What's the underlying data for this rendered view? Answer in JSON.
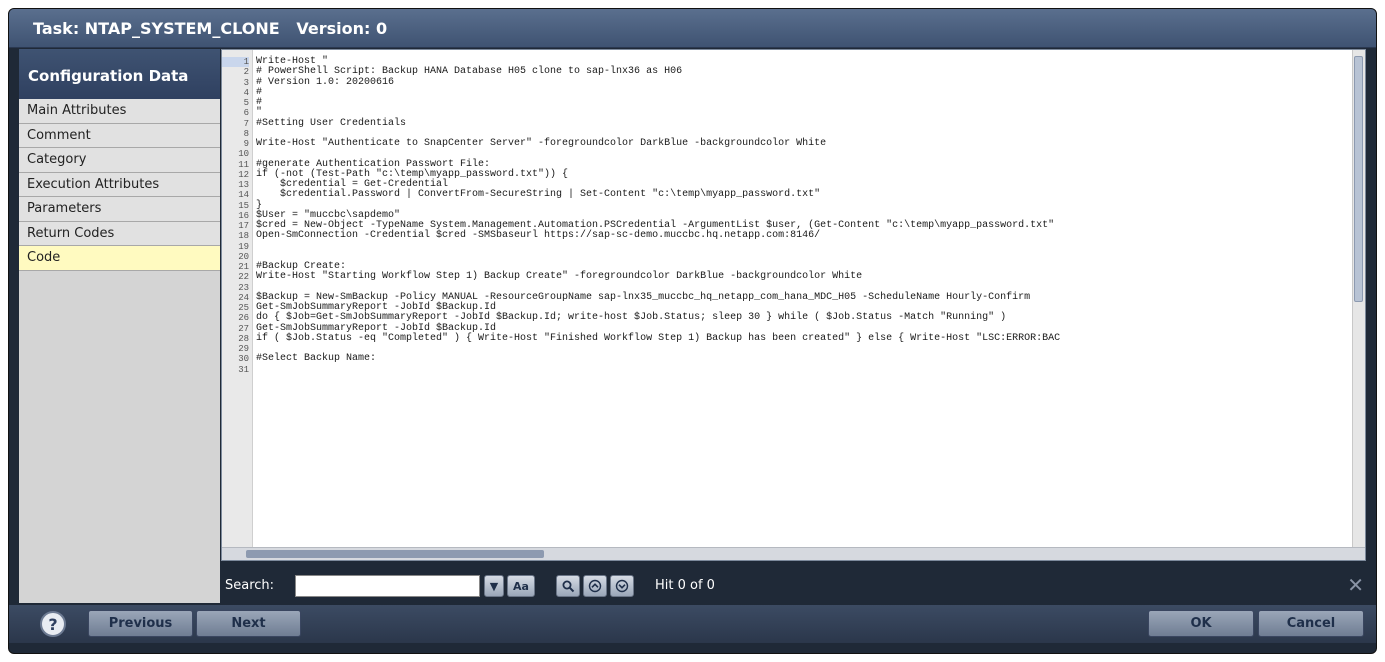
{
  "window": {
    "title": "Task: NTAP_SYSTEM_CLONE",
    "version_label": "Version: 0"
  },
  "sidebar": {
    "header": "Configuration Data",
    "items": [
      {
        "label": "Main Attributes"
      },
      {
        "label": "Comment"
      },
      {
        "label": "Category"
      },
      {
        "label": "Execution Attributes"
      },
      {
        "label": "Parameters"
      },
      {
        "label": "Return Codes"
      },
      {
        "label": "Code"
      }
    ],
    "active_item": "Code"
  },
  "editor": {
    "lines": [
      {
        "n": "1",
        "text": "Write-Host \""
      },
      {
        "n": "2",
        "text": "# PowerShell Script: Backup HANA Database H05 clone to sap-lnx36 as H06"
      },
      {
        "n": "3",
        "text": "# Version 1.0: 20200616"
      },
      {
        "n": "4",
        "text": "#"
      },
      {
        "n": "5",
        "text": "#"
      },
      {
        "n": "6",
        "text": "\""
      },
      {
        "n": "7",
        "text": "#Setting User Credentials"
      },
      {
        "n": "8",
        "text": ""
      },
      {
        "n": "9",
        "text": "Write-Host \"Authenticate to SnapCenter Server\" -foregroundcolor DarkBlue -backgroundcolor White"
      },
      {
        "n": "10",
        "text": ""
      },
      {
        "n": "11",
        "text": "#generate Authentication Passwort File:"
      },
      {
        "n": "12",
        "text": "if (-not (Test-Path \"c:\\temp\\myapp_password.txt\")) {"
      },
      {
        "n": "13",
        "text": "    $credential = Get-Credential"
      },
      {
        "n": "14",
        "text": "    $credential.Password | ConvertFrom-SecureString | Set-Content \"c:\\temp\\myapp_password.txt\""
      },
      {
        "n": "15",
        "text": "}"
      },
      {
        "n": "16",
        "text": "$User = \"muccbc\\sapdemo\""
      },
      {
        "n": "17",
        "text": "$cred = New-Object -TypeName System.Management.Automation.PSCredential -ArgumentList $user, (Get-Content \"c:\\temp\\myapp_password.txt\""
      },
      {
        "n": "18",
        "text": "Open-SmConnection -Credential $cred -SMSbaseurl https://sap-sc-demo.muccbc.hq.netapp.com:8146/"
      },
      {
        "n": "19",
        "text": ""
      },
      {
        "n": "20",
        "text": ""
      },
      {
        "n": "21",
        "text": "#Backup Create:"
      },
      {
        "n": "22",
        "text": "Write-Host \"Starting Workflow Step 1) Backup Create\" -foregroundcolor DarkBlue -backgroundcolor White"
      },
      {
        "n": "23",
        "text": ""
      },
      {
        "n": "24",
        "text": "$Backup = New-SmBackup -Policy MANUAL -ResourceGroupName sap-lnx35_muccbc_hq_netapp_com_hana_MDC_H05 -ScheduleName Hourly-Confirm"
      },
      {
        "n": "25",
        "text": "Get-SmJobSummaryReport -JobId $Backup.Id"
      },
      {
        "n": "26",
        "text": "do { $Job=Get-SmJobSummaryReport -JobId $Backup.Id; write-host $Job.Status; sleep 30 } while ( $Job.Status -Match \"Running\" )"
      },
      {
        "n": "27",
        "text": "Get-SmJobSummaryReport -JobId $Backup.Id"
      },
      {
        "n": "28",
        "text": "if ( $Job.Status -eq \"Completed\" ) { Write-Host \"Finished Workflow Step 1) Backup has been created\" } else { Write-Host \"LSC:ERROR:BAC"
      },
      {
        "n": "29",
        "text": ""
      },
      {
        "n": "30",
        "text": "#Select Backup Name:"
      },
      {
        "n": "31",
        "text": ""
      }
    ]
  },
  "search": {
    "label": "Search:",
    "value": "",
    "case_button": "Aa",
    "hit_text": "Hit 0 of 0"
  },
  "buttons": {
    "help": "?",
    "previous": "Previous",
    "next": "Next",
    "ok": "OK",
    "cancel": "Cancel"
  },
  "colors": {
    "frame_bg": "#1f2937",
    "title_bg": "#4a5e7e",
    "active_item_bg": "#fffac0"
  }
}
